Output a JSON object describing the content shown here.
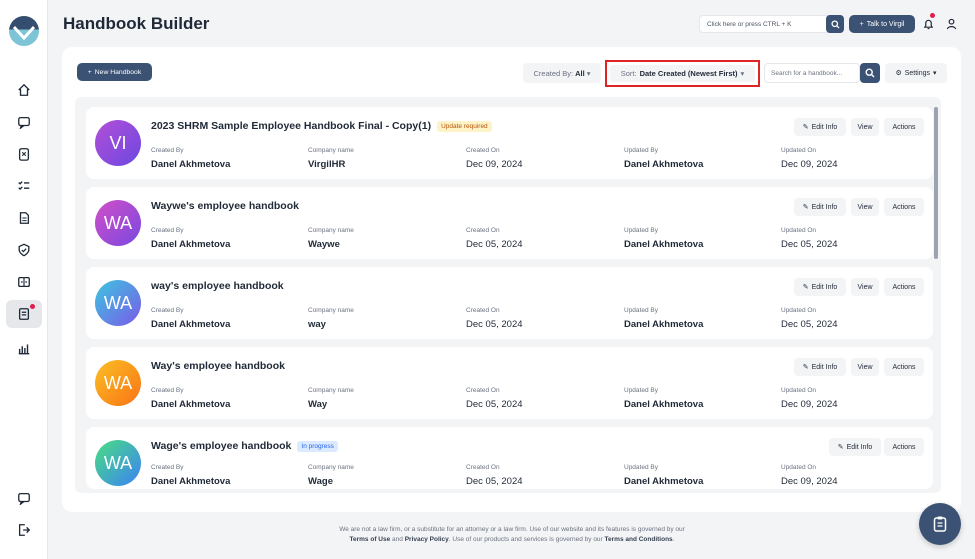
{
  "app": {
    "title": "Handbook Builder"
  },
  "header": {
    "command_search_placeholder": "Click here or press CTRL + K",
    "talk_label": "Talk to Virgil"
  },
  "toolbar": {
    "new_label": "New Handbook",
    "created_by_label": "Created By:",
    "created_by_value": "All",
    "sort_label": "Sort:",
    "sort_value": "Date Created (Newest First)",
    "search_placeholder": "Search for a handbook...",
    "settings_label": "Settings"
  },
  "columns": {
    "created_by": "Created By",
    "company": "Company name",
    "created_on": "Created On",
    "updated_by": "Updated By",
    "updated_on": "Updated On"
  },
  "card_buttons": {
    "edit": "Edit Info",
    "view": "View",
    "actions": "Actions"
  },
  "handbooks": [
    {
      "initials": "VI",
      "title": "2023 SHRM Sample Employee Handbook Final - Copy(1)",
      "badge": "Update required",
      "created_by": "Danel Akhmetova",
      "company": "VirgilHR",
      "created_on": "Dec 09, 2024",
      "updated_by": "Danel Akhmetova",
      "updated_on": "Dec 09, 2024"
    },
    {
      "initials": "WA",
      "title": "Waywe's employee handbook",
      "badge": "",
      "created_by": "Danel Akhmetova",
      "company": "Waywe",
      "created_on": "Dec 05, 2024",
      "updated_by": "Danel Akhmetova",
      "updated_on": "Dec 05, 2024"
    },
    {
      "initials": "WA",
      "title": "way's employee handbook",
      "badge": "",
      "created_by": "Danel Akhmetova",
      "company": "way",
      "created_on": "Dec 05, 2024",
      "updated_by": "Danel Akhmetova",
      "updated_on": "Dec 05, 2024"
    },
    {
      "initials": "WA",
      "title": "Way's employee handbook",
      "badge": "",
      "created_by": "Danel Akhmetova",
      "company": "Way",
      "created_on": "Dec 05, 2024",
      "updated_by": "Danel Akhmetova",
      "updated_on": "Dec 09, 2024"
    },
    {
      "initials": "WA",
      "title": "Wage's employee handbook",
      "badge": "In progress",
      "created_by": "Danel Akhmetova",
      "company": "Wage",
      "created_on": "Dec 05, 2024",
      "updated_by": "Danel Akhmetova",
      "updated_on": "Dec 09, 2024"
    }
  ],
  "footer": {
    "line1": "We are not a law firm, or a substitute for an attorney or a law firm. Use of our website and its features is governed by our",
    "terms_of_use": "Terms of Use",
    "and": "and",
    "privacy": "Privacy Policy",
    "line2_mid": ". Use of our products and services is governed by our",
    "terms_conditions": "Terms and Conditions",
    "period": "."
  },
  "colors": {
    "primary": "#3b5274",
    "highlight": "#e02424",
    "notification": "#e11d48"
  }
}
